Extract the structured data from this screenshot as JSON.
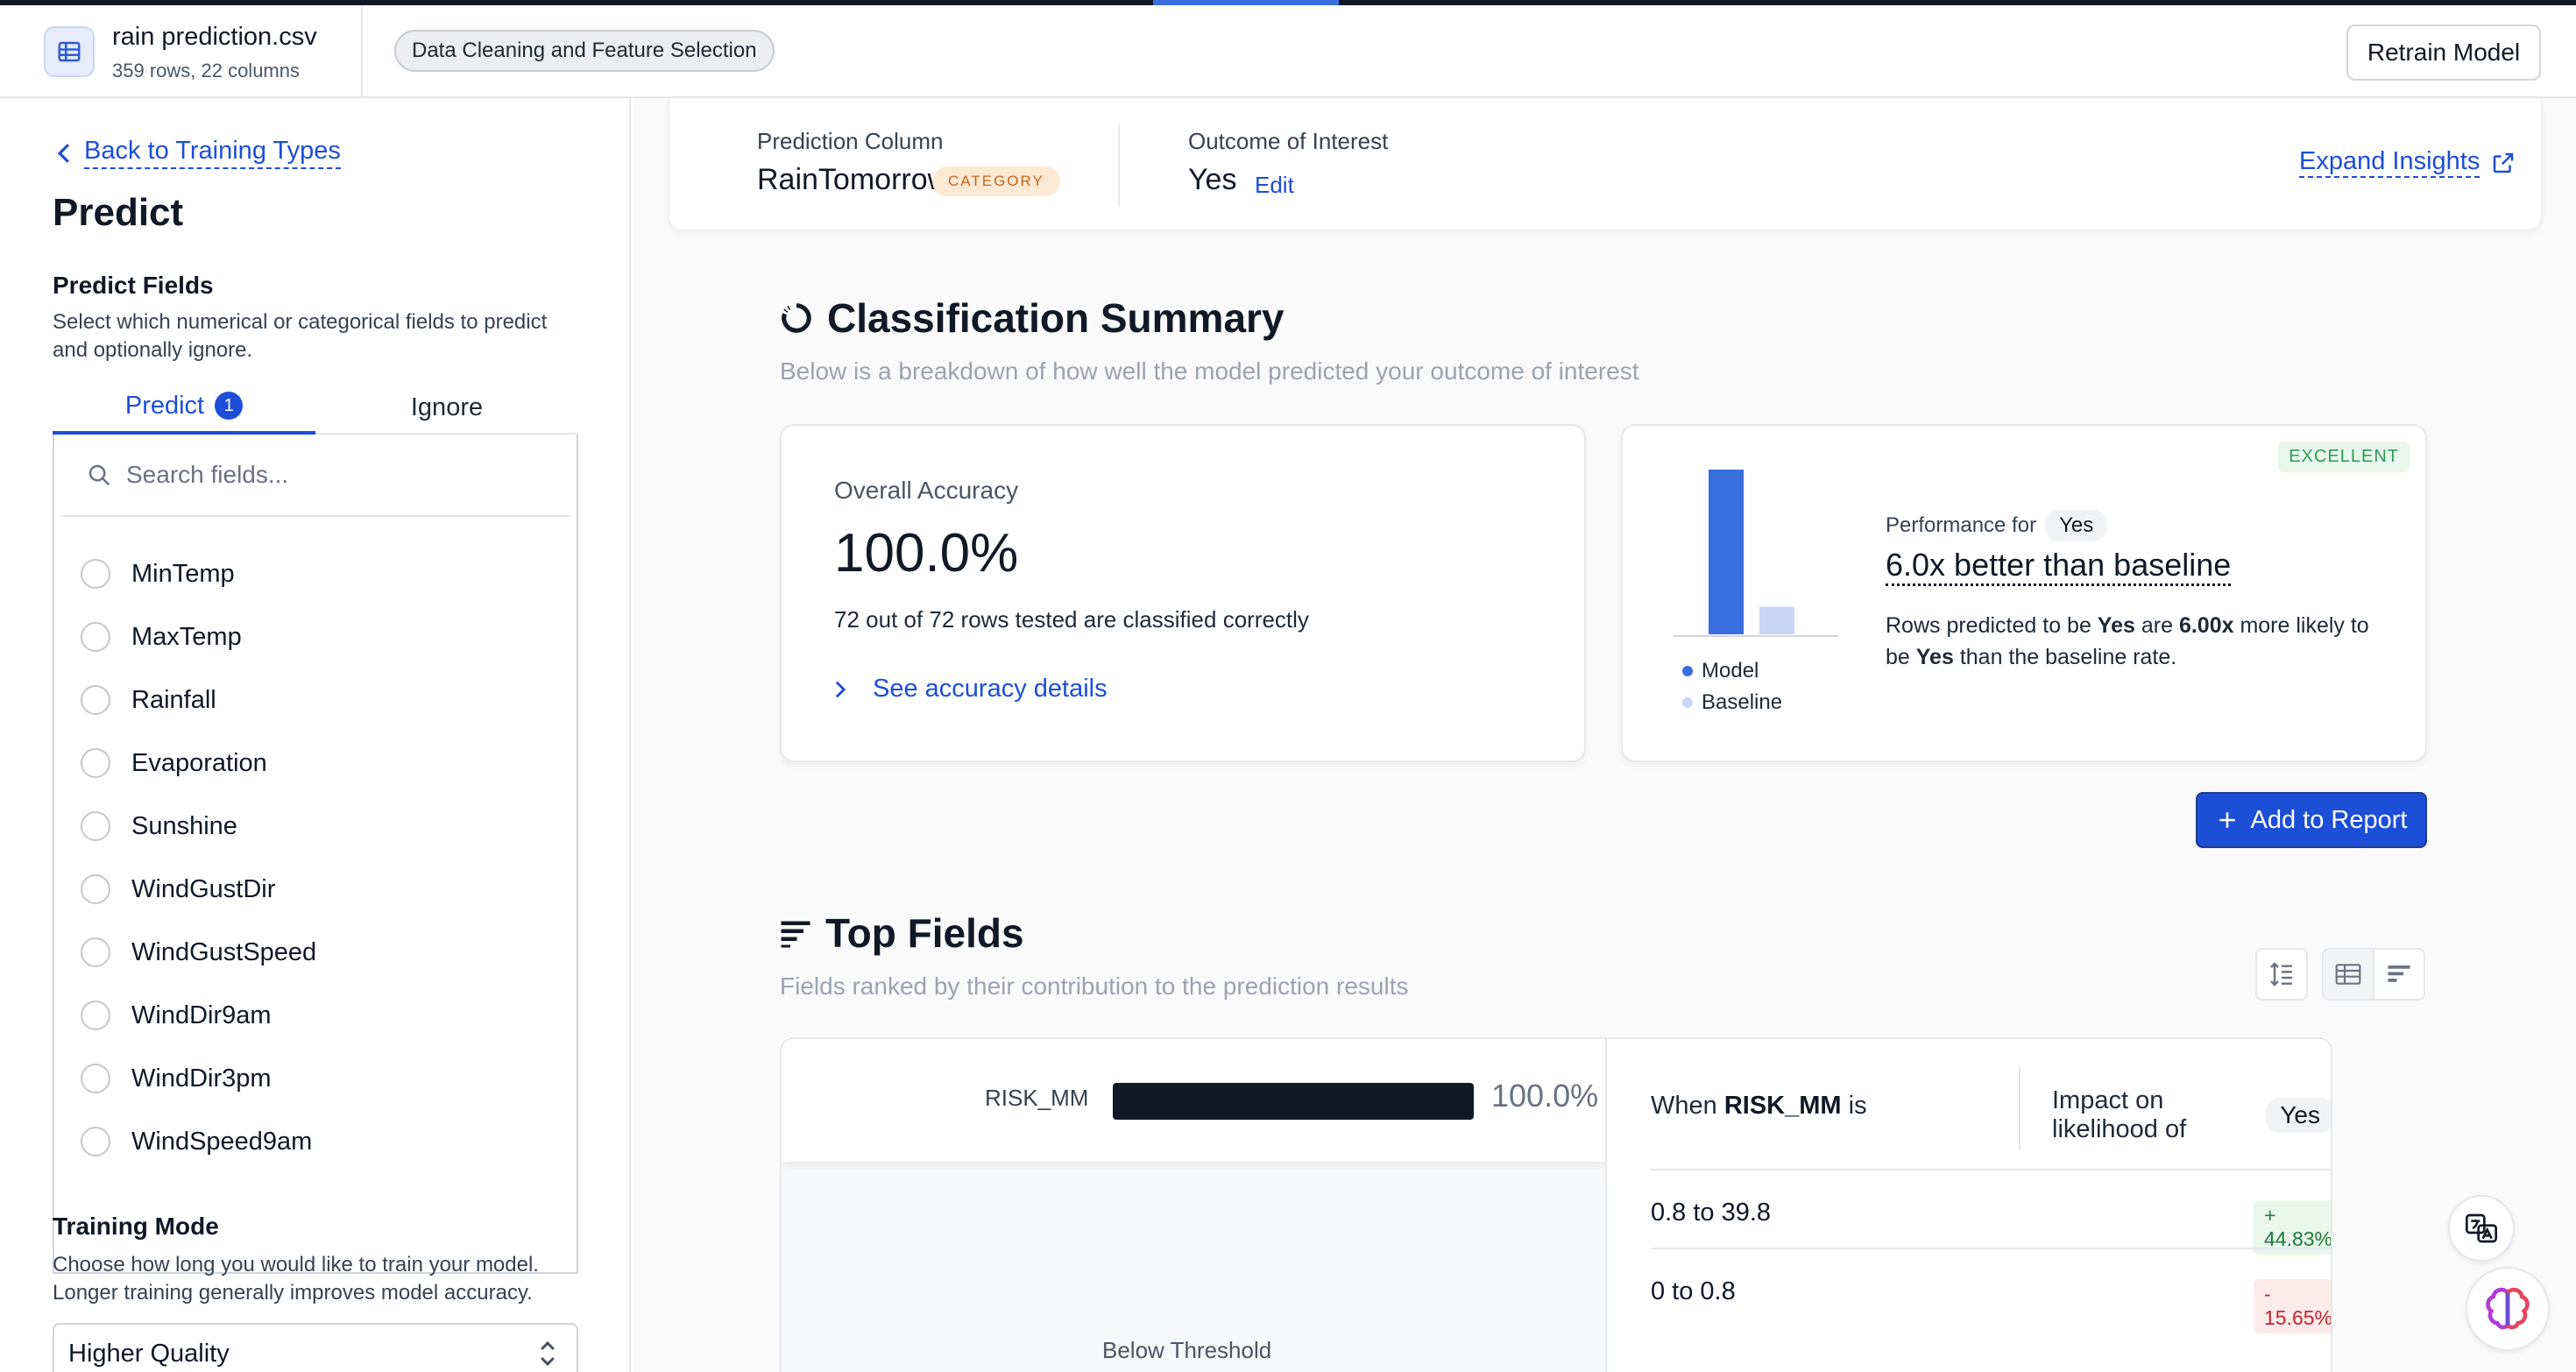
{
  "header": {
    "file_name": "rain prediction.csv",
    "file_meta": "359 rows, 22 columns",
    "step_chip": "Data Cleaning and Feature Selection",
    "retrain_label": "Retrain Model"
  },
  "sidebar": {
    "back_label": "Back to Training Types",
    "title": "Predict",
    "predict_fields_title": "Predict Fields",
    "predict_fields_desc": "Select which numerical or categorical fields to predict and optionally ignore.",
    "tabs": [
      {
        "label": "Predict",
        "badge": "1"
      },
      {
        "label": "Ignore"
      }
    ],
    "search_placeholder": "Search fields...",
    "fields": [
      "MinTemp",
      "MaxTemp",
      "Rainfall",
      "Evaporation",
      "Sunshine",
      "WindGustDir",
      "WindGustSpeed",
      "WindDir9am",
      "WindDir3pm",
      "WindSpeed9am"
    ],
    "training_mode_title": "Training Mode",
    "training_mode_desc": "Choose how long you would like to train your model. Longer training generally improves model accuracy.",
    "training_mode_value": "Higher Quality"
  },
  "prediction": {
    "column_label": "Prediction Column",
    "column_value": "RainTomorrow",
    "column_type": "CATEGORY",
    "outcome_label": "Outcome of Interest",
    "outcome_value": "Yes",
    "edit_label": "Edit",
    "expand_label": "Expand Insights"
  },
  "summary": {
    "title": "Classification Summary",
    "subtitle": "Below is a breakdown of how well the model predicted your outcome of interest",
    "accuracy_label": "Overall Accuracy",
    "accuracy_value": "100.0%",
    "accuracy_desc": "72 out of 72 rows tested are classified correctly",
    "accuracy_link": "See accuracy details",
    "rating": "EXCELLENT",
    "performance_for": "Performance for",
    "performance_outcome": "Yes",
    "performance_headline": "6.0x better than baseline",
    "performance_desc_1": "Rows predicted to be ",
    "performance_desc_yes1": "Yes",
    "performance_desc_2": " are ",
    "performance_desc_mult": "6.00x",
    "performance_desc_3": " more likely to be ",
    "performance_desc_yes2": "Yes",
    "performance_desc_4": " than the baseline rate.",
    "legend_model": "Model",
    "legend_baseline": "Baseline",
    "model_bar_relative": 1.0,
    "baseline_bar_relative": 0.167,
    "model_color": "#3b6fe0",
    "baseline_color": "#c7d6f6"
  },
  "add_report_label": "Add to Report",
  "top_fields": {
    "title": "Top Fields",
    "subtitle": "Fields ranked by their contribution to the prediction results",
    "field_name": "RISK_MM",
    "field_importance": "100.0%",
    "field_importance_fraction": 1.0,
    "below_threshold": "Below Threshold",
    "when_prefix": "When ",
    "when_field": "RISK_MM",
    "when_suffix": " is",
    "impact_label": "Impact on likelihood of",
    "impact_outcome": "Yes",
    "rows": [
      {
        "range": "0.8 to 39.8",
        "impact": "+ 44.83%"
      },
      {
        "range": "0 to 0.8",
        "impact": "- 15.65%"
      }
    ]
  },
  "icons": {
    "file": "table-icon",
    "back": "chevron-left-icon",
    "search": "search-icon",
    "select": "chevron-updown-icon",
    "expand": "external-link-icon",
    "summary": "donut-icon",
    "top_fields": "bars-icon",
    "add": "plus-icon",
    "translate": "translate-icon",
    "assistant": "brain-icon"
  }
}
